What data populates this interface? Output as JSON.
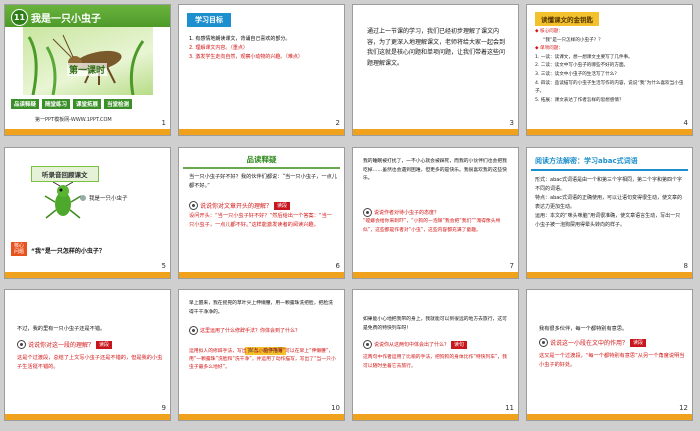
{
  "slides": [
    {
      "n": "1",
      "lesson_num": "11",
      "title": "我是一只小虫子",
      "keshi": "第一课时",
      "tabs": [
        "品读释疑",
        "随堂练习",
        "课堂拓展",
        "当堂检测"
      ],
      "site": "第一PPT模板网-WWW.1PPT.COM"
    },
    {
      "n": "2",
      "header": "学习目标",
      "goals": [
        "1. 有感情地朗读课文，背诵自己喜欢的部分。",
        "2. 理解课文内容。（重点）",
        "3. 激发学生走向自然，观察小动物的兴趣。（难点）"
      ]
    },
    {
      "n": "3",
      "text": "通过上一节课的学习，我们已经初步理解了课文内容，为了更深入地理解课文，老师将给大家一起会到我们这就是核心问题和单项问题，让我们带着这些问题理解课文。"
    },
    {
      "n": "4",
      "header": "读懂课文的金钥匙",
      "rows": [
        "◆ 核心问题：",
        "“我”是一只怎样的小虫子？？",
        "◆ 单项问题：",
        "1. 一读：读课文，想一想课文主要写了几件事。",
        "2. 二读：读文中写小虫子的哪些不好的方面。",
        "3. 三读：读文中小虫子的生活写了什么？",
        "4. 四读：品读描写的小虫子生活写作的内容，说说“我”为什么喜欢当小虫子。",
        "5. 拓展：课文表达了作者怎样的思想感情？"
      ]
    },
    {
      "n": "5",
      "header": "听录音回顾课文",
      "caption": "我是一只小虫子",
      "badge": "核心问题",
      "question": "“我”是一只怎样的小虫子？"
    },
    {
      "n": "6",
      "header": "品读释疑",
      "text": "当一只小虫子好不好？我的伙伴们都说：“当一只小虫子，一点儿都不好。”",
      "q": "说说你对文章开头的理解？",
      "tag": "读段",
      "answer": "设问开头：“当一只小虫子好不好？”然后给出一个答案：“当一只小虫子，一点儿都不好。”这样能激发读者的阅读兴趣。"
    },
    {
      "n": "7",
      "text": "我的睡眠被打扰了，一不小心就会被踩死，而我的小伙伴们也会把我吃掉……虽然也会遇到困难，但更多的是快乐。我很喜欢我的这些快乐。",
      "q": "说说作者对待小虫子的态度？",
      "answer": "“螳螂会给你来刺吓”，“小狗的一泡尿”我会把“我们”“淹得像头颅似”，这些都是作者对“小虫”，这些内容都充满了童趣。"
    },
    {
      "n": "8",
      "header": "阅读方法解密：学习abac式词语",
      "rows": [
        "形式：abac式词语是由一个和第三个字相同，第二个字和第四个字不同的词语。",
        "特点：abac式词语的正确使用，可以让语句变得很生动，使文章的表达力更加生动。",
        "运用：本文的“咪头咪脑”用词很准确，使文章语言生动，写出一只小虫子被一泡狗屎用得晕头转向的样子。"
      ]
    },
    {
      "n": "9",
      "text": "不过，我的里有一只小虫子还是不错。",
      "q": "说说你对这一段的理解？",
      "tag": "读段",
      "answer": "这是个过渡段，总结了上文写小虫子还是不错的，但是我的小虫子生活挺不错的。"
    },
    {
      "n": "10",
      "text": "早上醒来，我在摇晃的草叶尖上伸懒腰，用一颗露珠洗把脸，把脸洗得干干净净的。",
      "q": "这里运用了什么修辞手法？你体会到了什么？",
      "tag": "拟人、动作描写",
      "answer": "运用拟人的修辞手法，写出了“当小虫子不错”可以在早上“伸懒腰”，用“一颗露珠”洗脸和“洗干净”，并运用了动作描写，写出了“当一只小虫子最多么地好”。"
    },
    {
      "n": "11",
      "text": "如果能小心地把我带的身上，我就能可以到很远的地方去旅行，这可是免费的特快列车呀！",
      "q": "说说你从这两句中体会出了什么？",
      "tag": "读句",
      "answer": "这两句中作者运用了比喻的手法，把狗狗的身体比作“特快列车”，我可以随时坐着它去旅行。"
    },
    {
      "n": "12",
      "text": "我有很多伙伴，每一个都特别有意思。",
      "q": "说说这一小段在文中的作用？",
      "tag": "读段",
      "answer": "这又是一个过渡段，“每一个都特别有意思”从另一个角度说明当小虫子的好处。"
    }
  ]
}
